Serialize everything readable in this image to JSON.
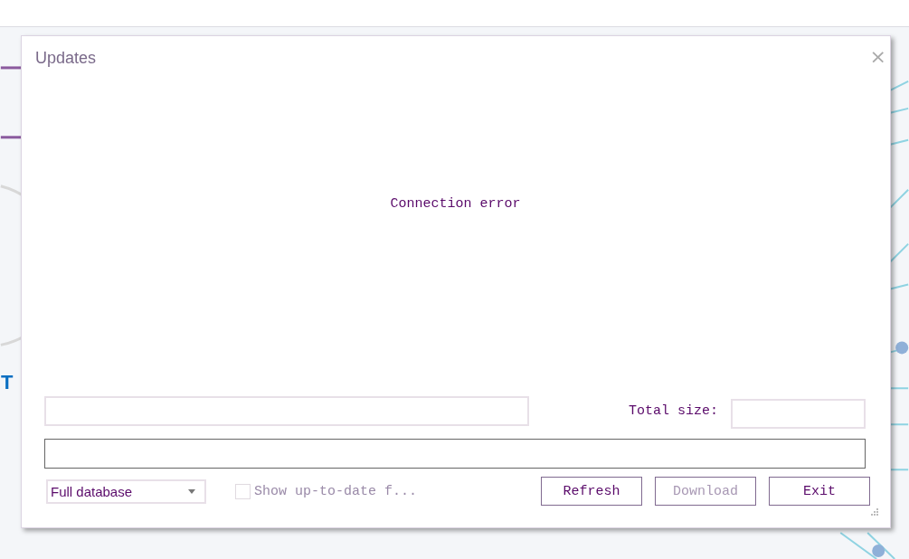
{
  "background_app": {
    "label": "T"
  },
  "window": {
    "title": "Updates",
    "close": "×"
  },
  "message": "Connection error",
  "total_size": {
    "label": "Total size:"
  },
  "database_dropdown": {
    "value": "Full database"
  },
  "show_up_to_date": {
    "label": "Show up-to-date f...",
    "checked": false,
    "disabled": true
  },
  "buttons": [
    {
      "label": "Refresh",
      "disabled": false
    },
    {
      "label": "Download",
      "disabled": true
    },
    {
      "label": "Exit",
      "disabled": false
    }
  ]
}
